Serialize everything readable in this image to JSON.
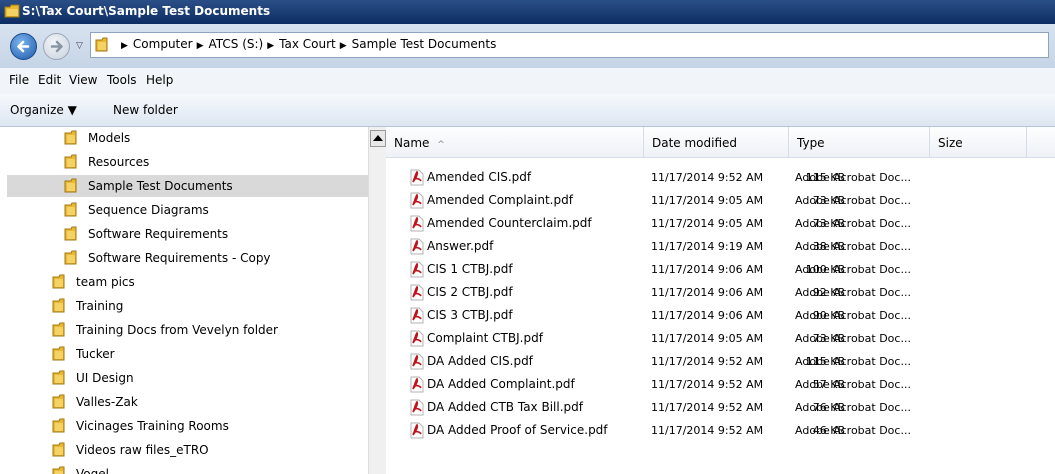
{
  "window": {
    "title": "S:\\Tax Court\\Sample Test Documents"
  },
  "address": {
    "crumbs": [
      "Computer",
      "ATCS (S:)",
      "Tax Court",
      "Sample Test Documents"
    ],
    "sep": "▶",
    "recent": "▽"
  },
  "menu": {
    "file": "File",
    "edit": "Edit",
    "view": "View",
    "tools": "Tools",
    "help": "Help"
  },
  "toolbar": {
    "organize": "Organize ▼",
    "new_folder": "New folder"
  },
  "nav": {
    "items": [
      {
        "label": "Models",
        "selected": false,
        "level": 1
      },
      {
        "label": "Resources",
        "selected": false,
        "level": 1
      },
      {
        "label": "Sample Test Documents",
        "selected": true,
        "level": 1
      },
      {
        "label": "Sequence Diagrams",
        "selected": false,
        "level": 1
      },
      {
        "label": "Software Requirements",
        "selected": false,
        "level": 1
      },
      {
        "label": "Software Requirements - Copy",
        "selected": false,
        "level": 1
      },
      {
        "label": "team pics",
        "selected": false,
        "level": 0
      },
      {
        "label": "Training",
        "selected": false,
        "level": 0
      },
      {
        "label": "Training Docs from Vevelyn folder",
        "selected": false,
        "level": 0
      },
      {
        "label": "Tucker",
        "selected": false,
        "level": 0
      },
      {
        "label": "UI Design",
        "selected": false,
        "level": 0
      },
      {
        "label": "Valles-Zak",
        "selected": false,
        "level": 0
      },
      {
        "label": "Vicinages Training Rooms",
        "selected": false,
        "level": 0
      },
      {
        "label": "Videos raw files_eTRO",
        "selected": false,
        "level": 0
      },
      {
        "label": "Vogel",
        "selected": false,
        "level": 0
      }
    ]
  },
  "columns": {
    "name": "Name",
    "sort_indicator": "^",
    "date": "Date modified",
    "type": "Type",
    "size": "Size"
  },
  "files": [
    {
      "name": "Amended CIS.pdf",
      "date": "11/17/2014 9:52 AM",
      "type": "Adobe Acrobat Doc...",
      "size": "115 KB"
    },
    {
      "name": "Amended Complaint.pdf",
      "date": "11/17/2014 9:05 AM",
      "type": "Adobe Acrobat Doc...",
      "size": "73 KB"
    },
    {
      "name": "Amended Counterclaim.pdf",
      "date": "11/17/2014 9:05 AM",
      "type": "Adobe Acrobat Doc...",
      "size": "73 KB"
    },
    {
      "name": "Answer.pdf",
      "date": "11/17/2014 9:19 AM",
      "type": "Adobe Acrobat Doc...",
      "size": "38 KB"
    },
    {
      "name": "CIS 1 CTBJ.pdf",
      "date": "11/17/2014 9:06 AM",
      "type": "Adobe Acrobat Doc...",
      "size": "100 KB"
    },
    {
      "name": "CIS 2 CTBJ.pdf",
      "date": "11/17/2014 9:06 AM",
      "type": "Adobe Acrobat Doc...",
      "size": "92 KB"
    },
    {
      "name": "CIS 3 CTBJ.pdf",
      "date": "11/17/2014 9:06 AM",
      "type": "Adobe Acrobat Doc...",
      "size": "90 KB"
    },
    {
      "name": "Complaint CTBJ.pdf",
      "date": "11/17/2014 9:05 AM",
      "type": "Adobe Acrobat Doc...",
      "size": "73 KB"
    },
    {
      "name": "DA Added CIS.pdf",
      "date": "11/17/2014 9:52 AM",
      "type": "Adobe Acrobat Doc...",
      "size": "115 KB"
    },
    {
      "name": "DA Added Complaint.pdf",
      "date": "11/17/2014 9:52 AM",
      "type": "Adobe Acrobat Doc...",
      "size": "57 KB"
    },
    {
      "name": "DA Added CTB Tax Bill.pdf",
      "date": "11/17/2014 9:52 AM",
      "type": "Adobe Acrobat Doc...",
      "size": "76 KB"
    },
    {
      "name": "DA Added Proof of Service.pdf",
      "date": "11/17/2014 9:52 AM",
      "type": "Adobe Acrobat Doc...",
      "size": "46 KB"
    }
  ],
  "colors": {
    "title_bar": "#0c2d63",
    "selection": "#d9d9d9",
    "folder": "#e8b931",
    "pdf_red": "#c1121b"
  }
}
